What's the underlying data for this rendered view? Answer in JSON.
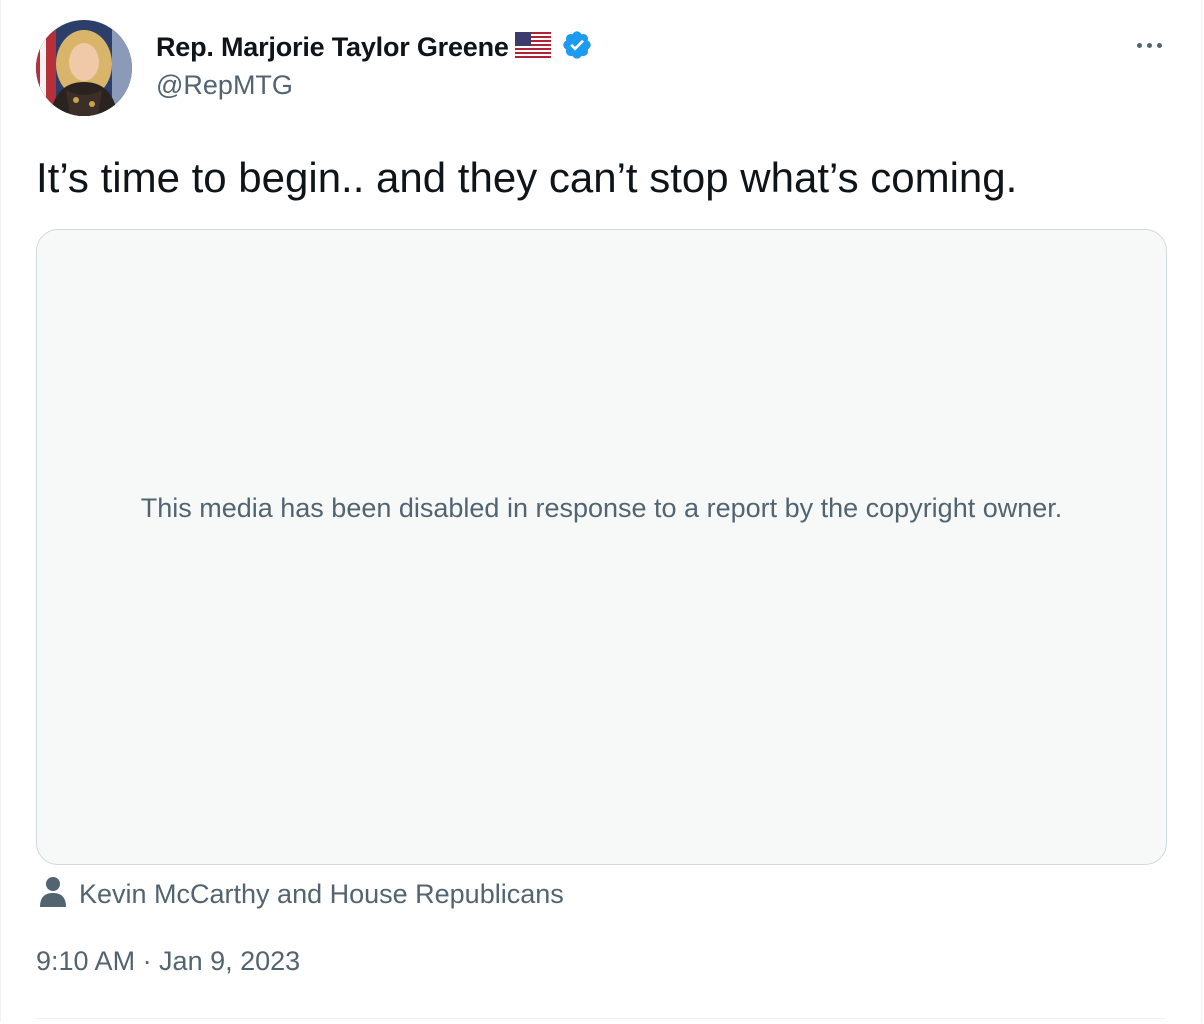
{
  "tweet": {
    "display_name": "Rep. Marjorie Taylor Greene",
    "flag_icon": "us-flag-emoji",
    "verified_icon": "verified-badge-icon",
    "handle": "@RepMTG",
    "text": "It’s time to begin.. and they can’t stop what’s coming.",
    "media_message": "This media has been disabled in response to a report by the copyright owner.",
    "tagged_people": "Kevin McCarthy and House Republicans",
    "timestamp": "9:10 AM · Jan 9, 2023"
  },
  "colors": {
    "text_primary": "#0f1419",
    "text_secondary": "#536471",
    "verified_blue": "#1d9bf0",
    "media_bg": "#f7f9f9",
    "media_border": "#cfd9de"
  }
}
